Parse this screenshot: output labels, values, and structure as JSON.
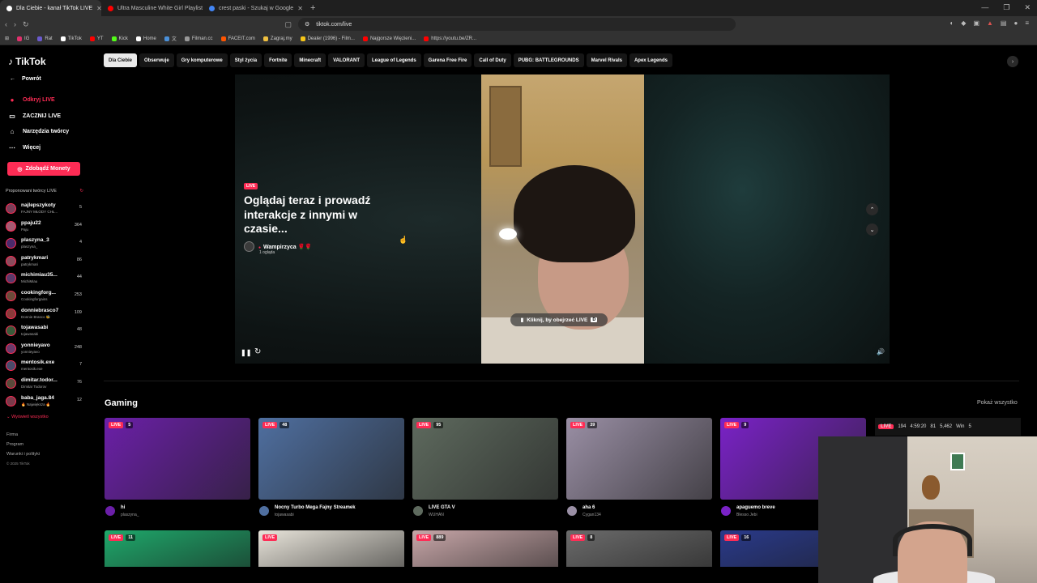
{
  "browser": {
    "tabs": [
      {
        "title": "Dla Ciebie - kanał TikTok LIVE",
        "active": true,
        "color": "#ffffff"
      },
      {
        "title": "Ultra Masculine White Girl Playlist fro",
        "active": false,
        "color": "#ff0000"
      },
      {
        "title": "crest paski - Szukaj w Google",
        "active": false,
        "color": "#4285f4"
      }
    ],
    "url": "tiktok.com/live",
    "bookmarks": [
      {
        "label": "IG",
        "color": "#e1306c"
      },
      {
        "label": "Rat",
        "color": "#6a5acd"
      },
      {
        "label": "TikTok",
        "color": "#ffffff"
      },
      {
        "label": "YT",
        "color": "#ff0000"
      },
      {
        "label": "Kick",
        "color": "#53fc18"
      },
      {
        "label": "Home",
        "color": "#ffffff"
      },
      {
        "label": "文",
        "color": "#4a90d9"
      },
      {
        "label": "Filman.cc",
        "color": "#999999"
      },
      {
        "label": "FACEIT.com",
        "color": "#ff5500"
      },
      {
        "label": "Zagraj.my",
        "color": "#f0c040"
      },
      {
        "label": "Dealer (1996) - Film...",
        "color": "#f5c518"
      },
      {
        "label": "Najgorsze Więzieni...",
        "color": "#ff0000"
      },
      {
        "label": "https://youtu.be/ZR...",
        "color": "#ff0000"
      }
    ]
  },
  "sidebar": {
    "logo": "TikTok",
    "back": "Powrót",
    "nav": [
      {
        "label": "Odkryj LIVE",
        "icon": "●",
        "active": true
      },
      {
        "label": "ZACZNIJ LIVE",
        "icon": "▭",
        "active": false
      },
      {
        "label": "Narzędzia twórcy",
        "icon": "⌂",
        "active": false
      },
      {
        "label": "Więcej",
        "icon": "⋯",
        "active": false
      }
    ],
    "coins_button": "Zdobądź Monety",
    "suggested_title": "Proponowani twórcy LIVE",
    "creators": [
      {
        "name": "najlepszykoty",
        "sub": "FAJNY MŁODY CHŁ...",
        "viewers": "5"
      },
      {
        "name": "ppaju22",
        "sub": "Paju",
        "viewers": "364"
      },
      {
        "name": "plaszyna_3",
        "sub": "plaszyna_",
        "viewers": "4"
      },
      {
        "name": "patrykmari",
        "sub": "patrykmari",
        "viewers": "86"
      },
      {
        "name": "michimiau35...",
        "sub": "MichiMiau",
        "viewers": "44"
      },
      {
        "name": "cookingforg...",
        "sub": "Cookingforgains",
        "viewers": "253"
      },
      {
        "name": "donniebrasco7",
        "sub": "Donnie Brasco 🐝",
        "viewers": "109"
      },
      {
        "name": "tojawasabi",
        "sub": "tojawasabi",
        "viewers": "48"
      },
      {
        "name": "yonnieyavo",
        "sub": "yonnieyavo",
        "viewers": "248"
      },
      {
        "name": "mentosik.exe",
        "sub": "mentosik.exe",
        "viewers": "7"
      },
      {
        "name": "dimitar.todor...",
        "sub": "Dimitar Todorov",
        "viewers": "76"
      },
      {
        "name": "baba_jaga.84",
        "sub": "🔥 Największa 🔥",
        "viewers": "12"
      }
    ],
    "show_all": "Wyświetl wszystko",
    "footer": [
      "Firma",
      "Program",
      "Warunki i polityki"
    ],
    "copyright": "© 2025 TikTok"
  },
  "categories": [
    "Dla Ciebie",
    "Obserwuje",
    "Gry komputerowe",
    "Styl życia",
    "Fortnite",
    "Minecraft",
    "VALORANT",
    "League of Legends",
    "Garena Free Fire",
    "Call of Duty",
    "PUBG: BATTLEGROUNDS",
    "Marvel Rivals",
    "Apex Legends"
  ],
  "player": {
    "live_label": "LIVE",
    "headline": "Oglądaj teraz i prowadź interakcje z innymi w czasie...",
    "host_name": "Wampirzyca 🌹🌹",
    "host_viewers": "1 ogląda",
    "watch_button": "Kliknij, by obejrzeć LIVE",
    "watch_key": "D"
  },
  "gaming": {
    "title": "Gaming",
    "show_all": "Pokaż wszystko",
    "cards": [
      {
        "viewers": "5",
        "title": "hi",
        "sub": "plaszyna_",
        "color": "#6b1fa8"
      },
      {
        "viewers": "48",
        "title": "Nocny Turbo Mega Fajny Streamek",
        "sub": "tojawasabi",
        "color": "#4f6fa0"
      },
      {
        "viewers": "95",
        "title": "LIVE GTA V",
        "sub": "WUHAN",
        "color": "#5e6a5e"
      },
      {
        "viewers": "39",
        "title": "aha 6",
        "sub": "Cygan134",
        "color": "#9a8fa5"
      },
      {
        "viewers": "9",
        "title": "apaguemo breve",
        "sub": "Blesso Jebi",
        "color": "#7a22c7"
      }
    ],
    "row2": [
      {
        "viewers": "11",
        "color": "#1fa86b"
      },
      {
        "viewers": "",
        "color": "#e8e4da"
      },
      {
        "viewers": "889",
        "color": "#c7a6a8"
      },
      {
        "viewers": "8",
        "color": "#6b6b6b"
      },
      {
        "viewers": "16",
        "color": "#2a3a8a"
      }
    ],
    "overlay_card": {
      "viewers": "194"
    }
  },
  "stats_overlay": [
    "4:59:20",
    "81",
    "5,462",
    "Win",
    "5"
  ]
}
